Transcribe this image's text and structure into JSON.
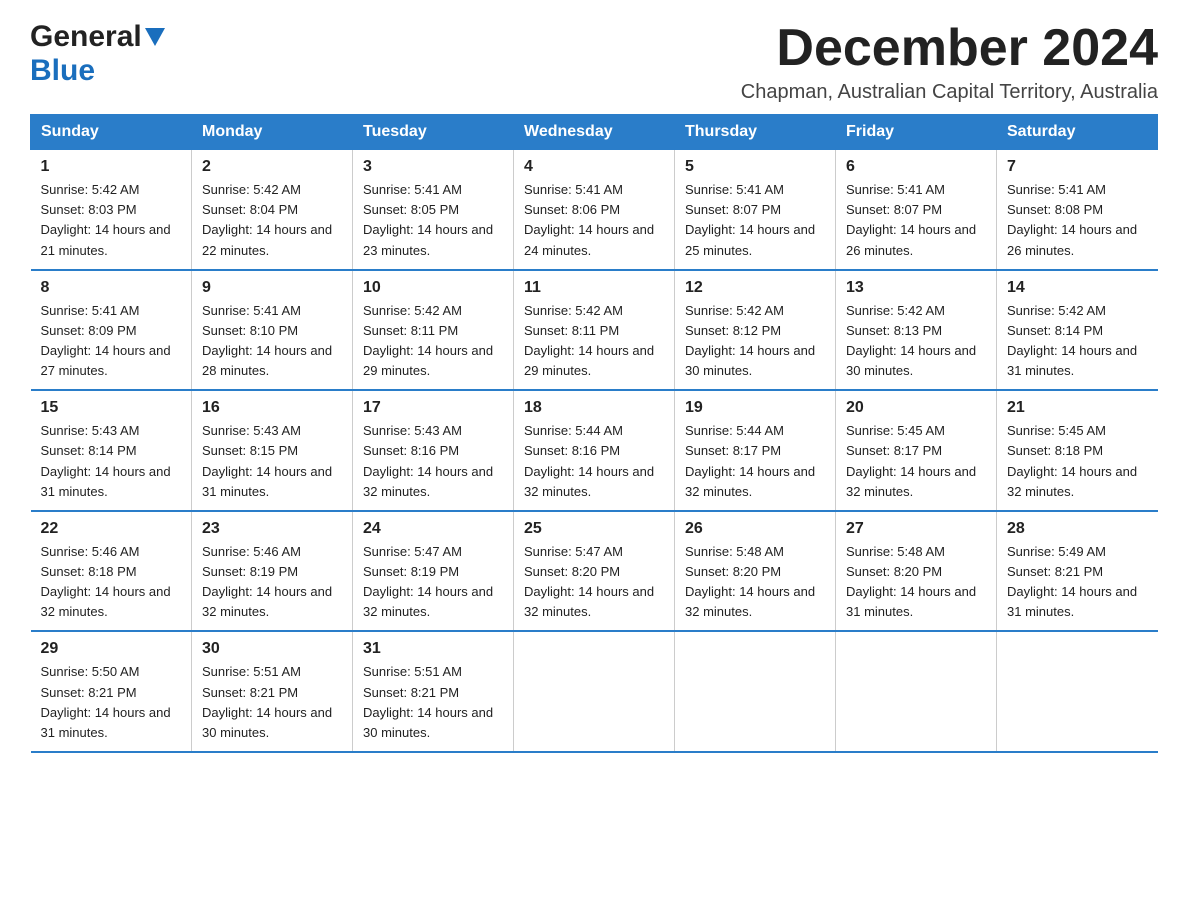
{
  "logo": {
    "general": "General",
    "blue": "Blue"
  },
  "header": {
    "month_year": "December 2024",
    "location": "Chapman, Australian Capital Territory, Australia"
  },
  "weekdays": [
    "Sunday",
    "Monday",
    "Tuesday",
    "Wednesday",
    "Thursday",
    "Friday",
    "Saturday"
  ],
  "weeks": [
    [
      {
        "day": "1",
        "sunrise": "5:42 AM",
        "sunset": "8:03 PM",
        "daylight": "14 hours and 21 minutes."
      },
      {
        "day": "2",
        "sunrise": "5:42 AM",
        "sunset": "8:04 PM",
        "daylight": "14 hours and 22 minutes."
      },
      {
        "day": "3",
        "sunrise": "5:41 AM",
        "sunset": "8:05 PM",
        "daylight": "14 hours and 23 minutes."
      },
      {
        "day": "4",
        "sunrise": "5:41 AM",
        "sunset": "8:06 PM",
        "daylight": "14 hours and 24 minutes."
      },
      {
        "day": "5",
        "sunrise": "5:41 AM",
        "sunset": "8:07 PM",
        "daylight": "14 hours and 25 minutes."
      },
      {
        "day": "6",
        "sunrise": "5:41 AM",
        "sunset": "8:07 PM",
        "daylight": "14 hours and 26 minutes."
      },
      {
        "day": "7",
        "sunrise": "5:41 AM",
        "sunset": "8:08 PM",
        "daylight": "14 hours and 26 minutes."
      }
    ],
    [
      {
        "day": "8",
        "sunrise": "5:41 AM",
        "sunset": "8:09 PM",
        "daylight": "14 hours and 27 minutes."
      },
      {
        "day": "9",
        "sunrise": "5:41 AM",
        "sunset": "8:10 PM",
        "daylight": "14 hours and 28 minutes."
      },
      {
        "day": "10",
        "sunrise": "5:42 AM",
        "sunset": "8:11 PM",
        "daylight": "14 hours and 29 minutes."
      },
      {
        "day": "11",
        "sunrise": "5:42 AM",
        "sunset": "8:11 PM",
        "daylight": "14 hours and 29 minutes."
      },
      {
        "day": "12",
        "sunrise": "5:42 AM",
        "sunset": "8:12 PM",
        "daylight": "14 hours and 30 minutes."
      },
      {
        "day": "13",
        "sunrise": "5:42 AM",
        "sunset": "8:13 PM",
        "daylight": "14 hours and 30 minutes."
      },
      {
        "day": "14",
        "sunrise": "5:42 AM",
        "sunset": "8:14 PM",
        "daylight": "14 hours and 31 minutes."
      }
    ],
    [
      {
        "day": "15",
        "sunrise": "5:43 AM",
        "sunset": "8:14 PM",
        "daylight": "14 hours and 31 minutes."
      },
      {
        "day": "16",
        "sunrise": "5:43 AM",
        "sunset": "8:15 PM",
        "daylight": "14 hours and 31 minutes."
      },
      {
        "day": "17",
        "sunrise": "5:43 AM",
        "sunset": "8:16 PM",
        "daylight": "14 hours and 32 minutes."
      },
      {
        "day": "18",
        "sunrise": "5:44 AM",
        "sunset": "8:16 PM",
        "daylight": "14 hours and 32 minutes."
      },
      {
        "day": "19",
        "sunrise": "5:44 AM",
        "sunset": "8:17 PM",
        "daylight": "14 hours and 32 minutes."
      },
      {
        "day": "20",
        "sunrise": "5:45 AM",
        "sunset": "8:17 PM",
        "daylight": "14 hours and 32 minutes."
      },
      {
        "day": "21",
        "sunrise": "5:45 AM",
        "sunset": "8:18 PM",
        "daylight": "14 hours and 32 minutes."
      }
    ],
    [
      {
        "day": "22",
        "sunrise": "5:46 AM",
        "sunset": "8:18 PM",
        "daylight": "14 hours and 32 minutes."
      },
      {
        "day": "23",
        "sunrise": "5:46 AM",
        "sunset": "8:19 PM",
        "daylight": "14 hours and 32 minutes."
      },
      {
        "day": "24",
        "sunrise": "5:47 AM",
        "sunset": "8:19 PM",
        "daylight": "14 hours and 32 minutes."
      },
      {
        "day": "25",
        "sunrise": "5:47 AM",
        "sunset": "8:20 PM",
        "daylight": "14 hours and 32 minutes."
      },
      {
        "day": "26",
        "sunrise": "5:48 AM",
        "sunset": "8:20 PM",
        "daylight": "14 hours and 32 minutes."
      },
      {
        "day": "27",
        "sunrise": "5:48 AM",
        "sunset": "8:20 PM",
        "daylight": "14 hours and 31 minutes."
      },
      {
        "day": "28",
        "sunrise": "5:49 AM",
        "sunset": "8:21 PM",
        "daylight": "14 hours and 31 minutes."
      }
    ],
    [
      {
        "day": "29",
        "sunrise": "5:50 AM",
        "sunset": "8:21 PM",
        "daylight": "14 hours and 31 minutes."
      },
      {
        "day": "30",
        "sunrise": "5:51 AM",
        "sunset": "8:21 PM",
        "daylight": "14 hours and 30 minutes."
      },
      {
        "day": "31",
        "sunrise": "5:51 AM",
        "sunset": "8:21 PM",
        "daylight": "14 hours and 30 minutes."
      },
      null,
      null,
      null,
      null
    ]
  ],
  "labels": {
    "sunrise_prefix": "Sunrise: ",
    "sunset_prefix": "Sunset: ",
    "daylight_prefix": "Daylight: "
  }
}
